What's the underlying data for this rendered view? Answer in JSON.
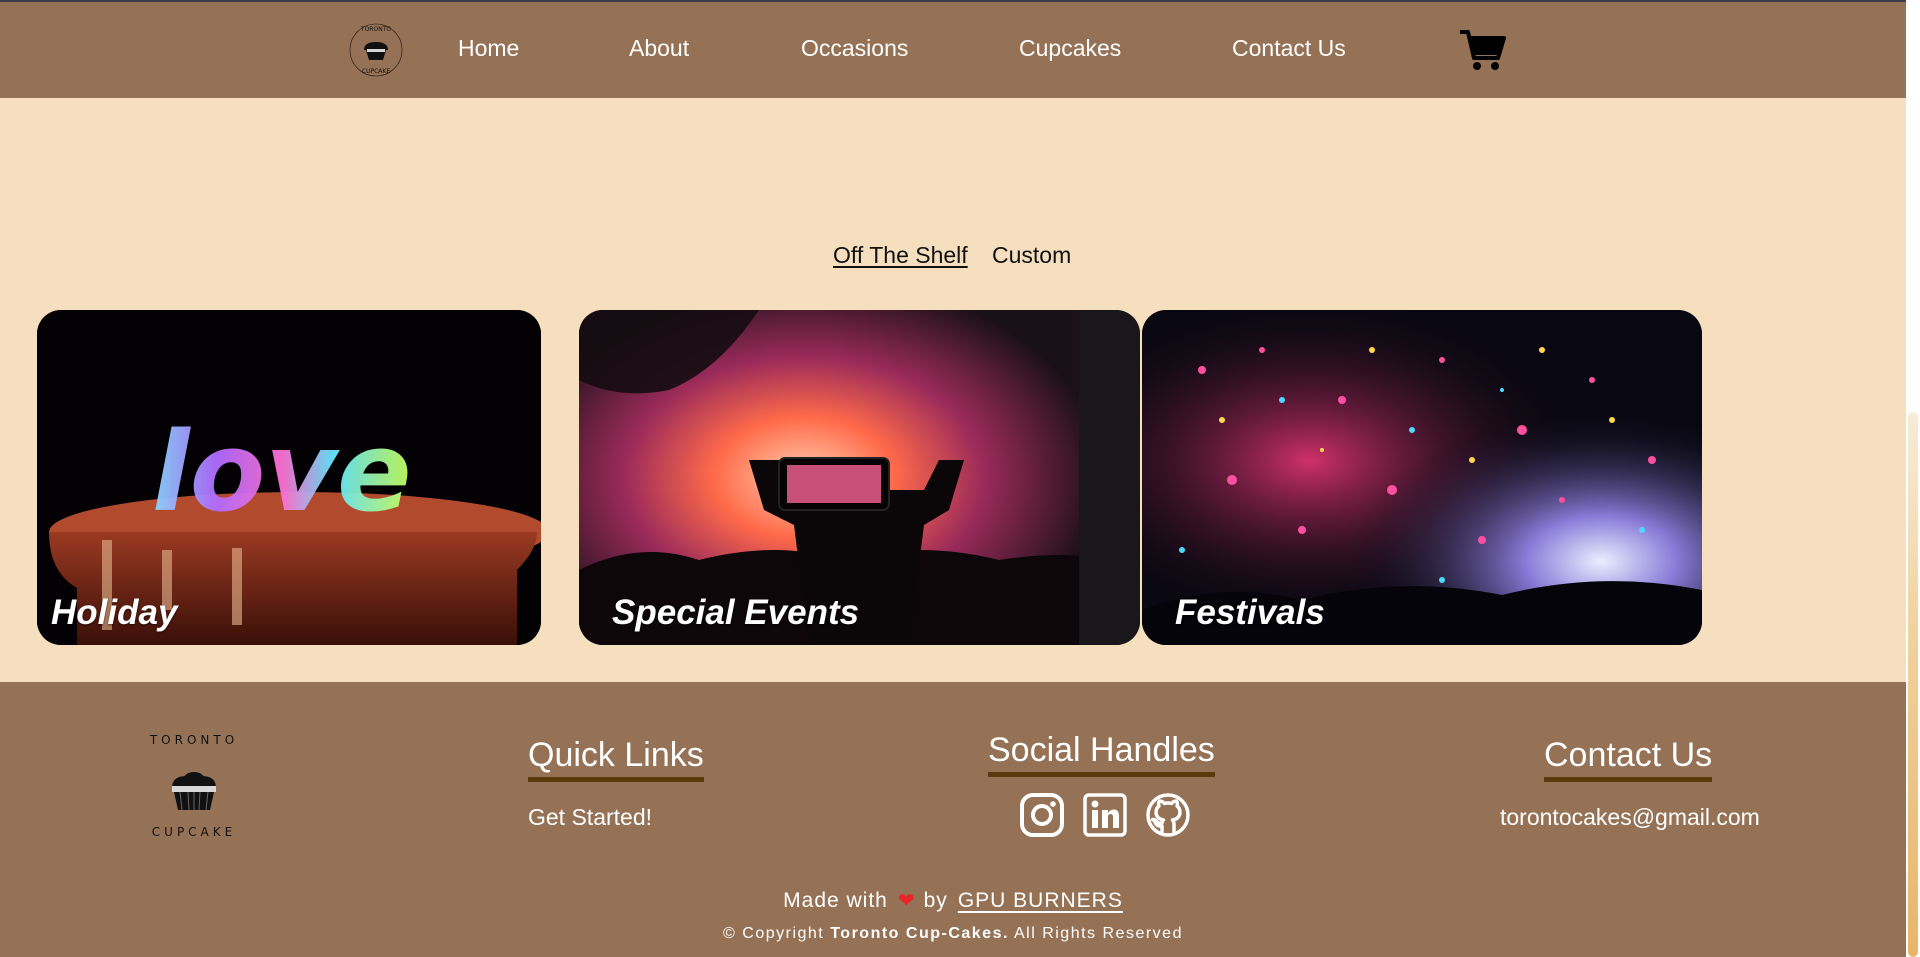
{
  "nav": {
    "logo_text": "TORONTO CUPCAKE",
    "items": [
      {
        "label": "Home"
      },
      {
        "label": "About"
      },
      {
        "label": "Occasions"
      },
      {
        "label": "Cupcakes"
      },
      {
        "label": "Contact Us"
      }
    ],
    "cart_icon": "shopping-cart-icon"
  },
  "tabs": [
    {
      "label": "Off The Shelf",
      "active": true
    },
    {
      "label": "Custom",
      "active": false
    }
  ],
  "cards": [
    {
      "label": "Holiday",
      "image_text": "love"
    },
    {
      "label": "Special Events"
    },
    {
      "label": "Festivals"
    }
  ],
  "footer": {
    "logo_text": "TORONTO CUPCAKE",
    "quick_links": {
      "heading": "Quick Links",
      "items": [
        "Get Started!"
      ]
    },
    "social": {
      "heading": "Social Handles",
      "icons": [
        "instagram-icon",
        "linkedin-icon",
        "github-icon"
      ]
    },
    "contact": {
      "heading": "Contact Us",
      "email": "torontocakes@gmail.com"
    },
    "made_with_prefix": "Made with",
    "made_with_by": "by",
    "made_with_team": "GPU BURNERS",
    "copyright_prefix": "© Copyright",
    "copyright_company": "Toronto Cup-Cakes.",
    "copyright_suffix": "All Rights Reserved"
  },
  "colors": {
    "nav_bg": "#957256",
    "page_bg": "#f5dfbf",
    "heading_underline": "#5b3a0e"
  }
}
